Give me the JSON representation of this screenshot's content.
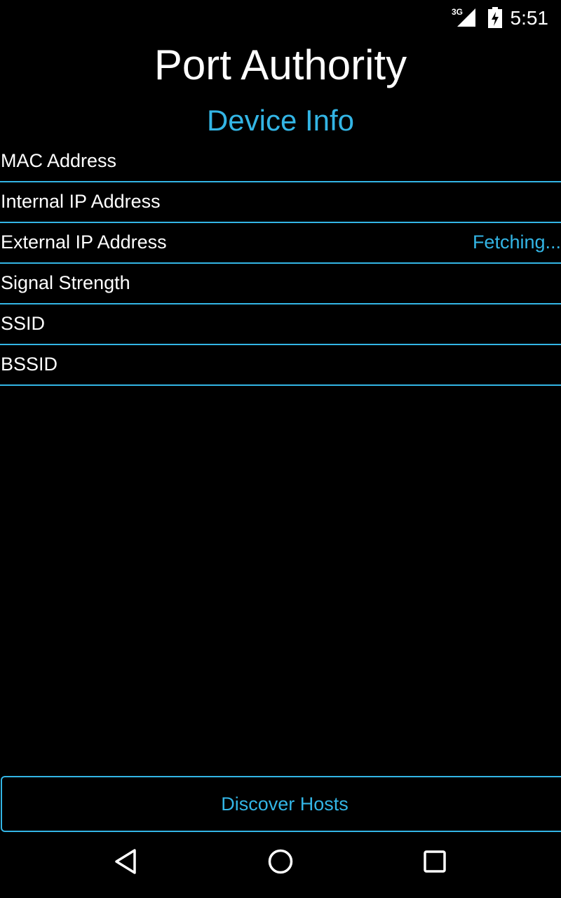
{
  "status_bar": {
    "network_type": "3G",
    "time": "5:51",
    "signal_icon": "signal-icon",
    "battery_icon": "battery-charging-icon"
  },
  "app": {
    "title": "Port Authority"
  },
  "device_info": {
    "title": "Device Info",
    "rows": [
      {
        "label": "MAC Address",
        "value": ""
      },
      {
        "label": "Internal IP Address",
        "value": ""
      },
      {
        "label": "External IP Address",
        "value": "Fetching..."
      },
      {
        "label": "Signal Strength",
        "value": ""
      },
      {
        "label": "SSID",
        "value": ""
      },
      {
        "label": "BSSID",
        "value": ""
      }
    ]
  },
  "actions": {
    "discover_hosts_label": "Discover Hosts"
  },
  "nav_bar": {
    "back_icon": "back-triangle-icon",
    "home_icon": "home-circle-icon",
    "recents_icon": "recents-square-icon"
  },
  "colors": {
    "accent": "#33b5e5",
    "background": "#000000",
    "text": "#ffffff"
  }
}
